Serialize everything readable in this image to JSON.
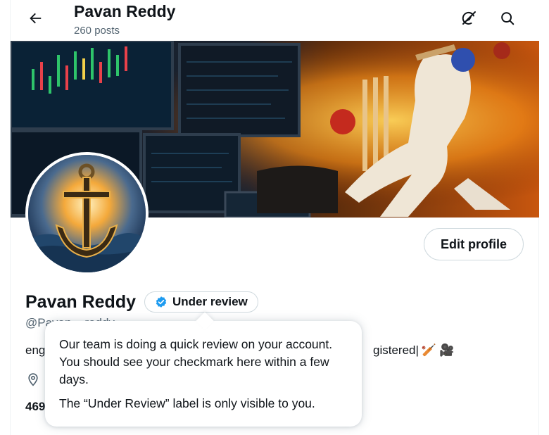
{
  "header": {
    "title": "Pavan Reddy",
    "post_count": "260 posts",
    "back_icon": "arrow-left-icon",
    "grok_icon": "grok-slash-icon",
    "search_icon": "search-icon"
  },
  "profile": {
    "name": "Pavan Reddy",
    "verification_label": "Under review",
    "handle": "@Pavan__reddy",
    "bio_start": "eng",
    "bio_end": "gistered|",
    "bio_emojis": [
      "🏏",
      "🎥"
    ],
    "following_count_partial": "469",
    "edit_profile_label": "Edit profile"
  },
  "tooltip": {
    "message": "Our team is doing a quick review on your account. You should see your checkmark here within a few days.",
    "note": "The “Under Review” label is only visible to you."
  },
  "colors": {
    "accent": "#1d9bf0",
    "text_primary": "#0f1419",
    "text_secondary": "#536471",
    "border": "#cfd9de"
  }
}
